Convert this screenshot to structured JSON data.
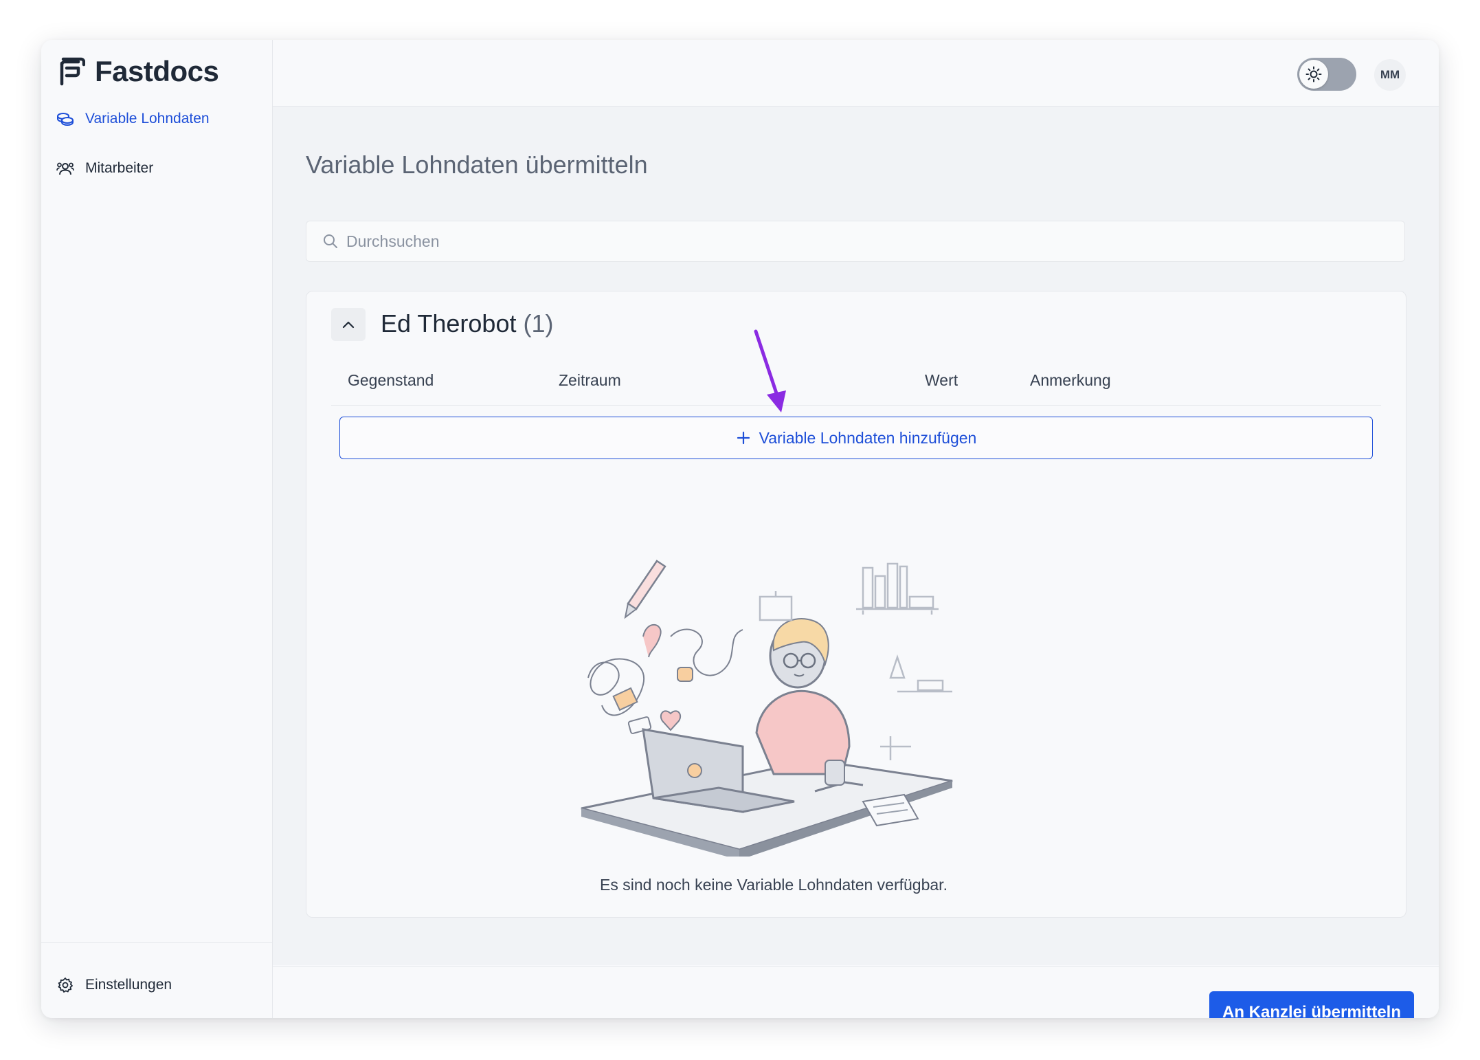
{
  "app": {
    "name": "Fastdocs"
  },
  "sidebar": {
    "items": [
      {
        "label": "Variable Lohndaten",
        "icon": "coins-icon",
        "active": true
      },
      {
        "label": "Mitarbeiter",
        "icon": "users-icon",
        "active": false
      }
    ],
    "settings_label": "Einstellungen"
  },
  "header": {
    "theme": "light",
    "avatar_initials": "MM"
  },
  "main": {
    "title": "Variable Lohndaten übermitteln",
    "search": {
      "placeholder": "Durchsuchen",
      "value": ""
    },
    "group": {
      "name": "Ed Therobot",
      "count_label": "(1)",
      "expanded": true,
      "columns": [
        "Gegenstand",
        "Zeitraum",
        "Wert",
        "Anmerkung"
      ],
      "add_label": "Variable Lohndaten hinzufügen",
      "empty_text": "Es sind noch keine Variable Lohndaten verfügbar."
    },
    "submit_label": "An Kanzlei übermitteln"
  },
  "colors": {
    "accent": "#1d4ed8",
    "annotation_arrow": "#8b2be2"
  }
}
